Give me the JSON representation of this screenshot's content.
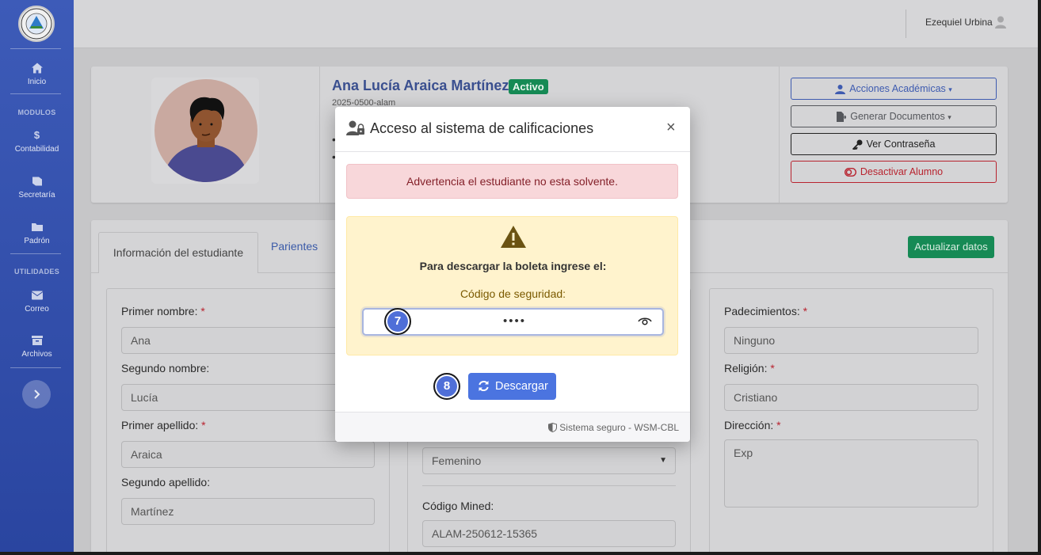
{
  "sidebar": {
    "items": [
      {
        "label": "Inicio",
        "icon": "home-icon"
      },
      {
        "label": "Contabilidad",
        "icon": "dollar-icon"
      },
      {
        "label": "Secretaría",
        "icon": "book-icon"
      },
      {
        "label": "Padrón",
        "icon": "folder-icon"
      },
      {
        "label": "Correo",
        "icon": "envelope-icon"
      },
      {
        "label": "Archivos",
        "icon": "archive-icon"
      }
    ],
    "headings": {
      "modulos": "MODULOS",
      "utilidades": "UTILIDADES"
    }
  },
  "header": {
    "user_name": "Ezequiel Urbina"
  },
  "student": {
    "name": "Ana Lucía Araica Martínez",
    "status": "Activo",
    "code": "2025-0500-alam"
  },
  "actions": {
    "academic": "Acciones Académicas",
    "documents": "Generar Documentos",
    "password": "Ver Contraseña",
    "deactivate": "Desactivar Alumno"
  },
  "tabs": {
    "info": "Información del estudiante",
    "parents": "Parientes"
  },
  "update_button": "Actualizar datos",
  "form": {
    "first_name_label": "Primer nombre:",
    "first_name": "Ana",
    "second_name_label": "Segundo nombre:",
    "second_name": "Lucía",
    "first_surname_label": "Primer apellido:",
    "first_surname": "Araica",
    "second_surname_label": "Segundo apellido:",
    "second_surname": "Martínez",
    "gender": "Femenino",
    "mined_label": "Código Mined:",
    "mined": "ALAM-250612-15365",
    "conditions_label": "Padecimientos:",
    "conditions": "Ninguno",
    "religion_label": "Religión:",
    "religion": "Cristiano",
    "address_label": "Dirección:",
    "address": "Exp"
  },
  "modal": {
    "title": "Acceso al sistema de calificaciones",
    "alert": "Advertencia el estudiante no esta solvente.",
    "instruction": "Para descargar la boleta ingrese el:",
    "code_label": "Código de seguridad:",
    "code_value": "••••",
    "download": "Descargar",
    "footer": "Sistema seguro - WSM-CBL",
    "step_input": "7",
    "step_button": "8"
  },
  "colors": {
    "primary": "#4b74e0",
    "sidebar": "#2f4aa6",
    "success": "#168a55",
    "danger": "#b8232f"
  }
}
